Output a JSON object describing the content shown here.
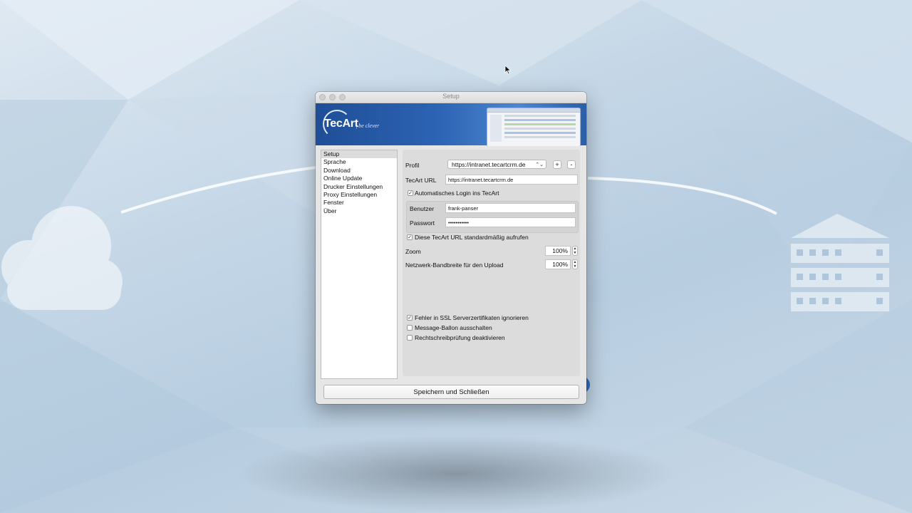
{
  "window": {
    "title": "Setup"
  },
  "banner": {
    "logo": "TecArt",
    "slogan": "| be clever"
  },
  "sidebar": {
    "items": [
      {
        "label": "Setup",
        "selected": true
      },
      {
        "label": "Sprache"
      },
      {
        "label": "Download"
      },
      {
        "label": "Online Update"
      },
      {
        "label": "Drucker Einstellungen"
      },
      {
        "label": "Proxy Einstellungen"
      },
      {
        "label": "Fenster"
      },
      {
        "label": "Über"
      }
    ]
  },
  "setup": {
    "profil_label": "Profil",
    "profil_value": "https://intranet.tecartcrm.de",
    "add_label": "+",
    "remove_label": "-",
    "url_label": "TecArt URL",
    "url_value": "https://intranet.tecartcrm.de",
    "auto_login_label": "Automatisches Login ins TecArt",
    "auto_login_checked": true,
    "user_label": "Benutzer",
    "user_value": "frank-panser",
    "password_label": "Passwort",
    "password_value": "•••••••••••",
    "default_url_label": "Diese TecArt URL standardmäßig aufrufen",
    "default_url_checked": true,
    "zoom_label": "Zoom",
    "zoom_value": "100%",
    "bandwidth_label": "Netzwerk-Bandbreite für den Upload",
    "bandwidth_value": "100%",
    "ssl_label": "Fehler in SSL Serverzertifikaten ignorieren",
    "ssl_checked": true,
    "balloon_label": "Message-Ballon ausschalten",
    "balloon_checked": false,
    "spell_label": "Rechtschreibprüfung deaktivieren",
    "spell_checked": false,
    "check_mark": "✓"
  },
  "footer": {
    "save_label": "Speichern und Schließen"
  },
  "colors": {
    "banner": "#2c63b3",
    "background": "#c5d7e7"
  }
}
